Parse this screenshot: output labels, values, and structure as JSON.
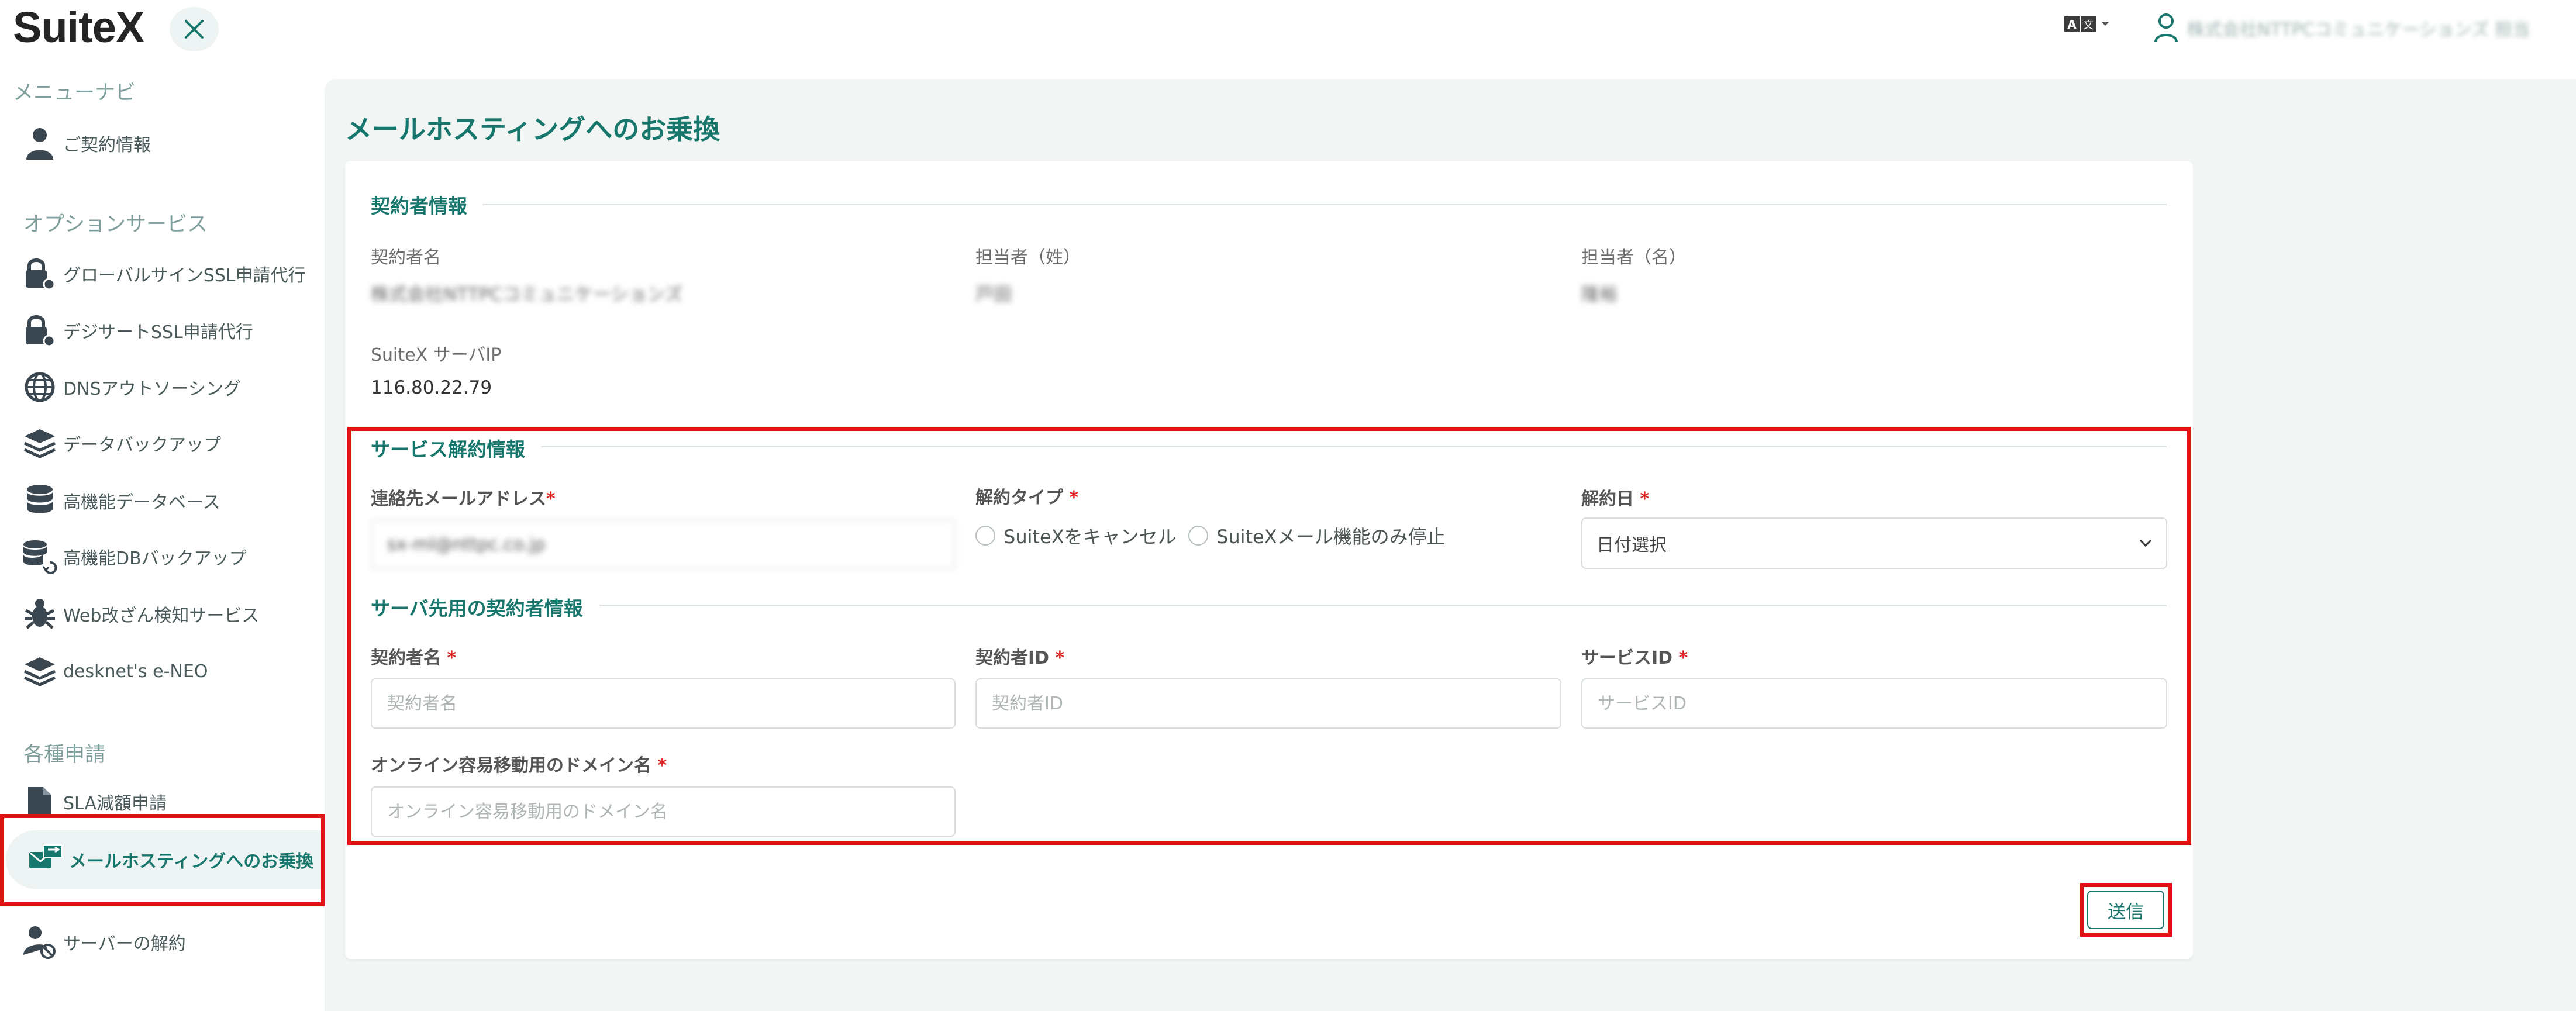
{
  "header": {
    "logo": "SuiteX",
    "user_name": "株式会社NTTPCコミュニケーションズ 担当"
  },
  "sidebar": {
    "menu_title": "メニューナビ",
    "contract_info": "ご契約情報",
    "options_title": "オプションサービス",
    "options": [
      {
        "label": "グローバルサインSSL申請代行",
        "icon": "lock-gear-icon"
      },
      {
        "label": "デジサートSSL申請代行",
        "icon": "lock-gear-icon"
      },
      {
        "label": "DNSアウトソーシング",
        "icon": "globe-icon"
      },
      {
        "label": "データバックアップ",
        "icon": "layers-icon"
      },
      {
        "label": "高機能データベース",
        "icon": "database-icon"
      },
      {
        "label": "高機能DBバックアップ",
        "icon": "database-restore-icon"
      },
      {
        "label": "Web改ざん検知サービス",
        "icon": "bug-icon"
      },
      {
        "label": "desknet's e-NEO",
        "icon": "layers-icon"
      }
    ],
    "requests_title": "各種申請",
    "requests": [
      {
        "label": "SLA減額申請",
        "icon": "document-icon"
      },
      {
        "label": "メールホスティングへのお乗換",
        "icon": "mail-transfer-icon"
      },
      {
        "label": "サーバーの解約",
        "icon": "user-block-icon"
      }
    ]
  },
  "main": {
    "page_title": "メールホスティングへのお乗換",
    "contractor": {
      "title": "契約者情報",
      "name_label": "契約者名",
      "name_value": "株式会社NTTPCコミュニケーションズ",
      "last_label": "担当者（姓）",
      "last_value": "戸田",
      "first_label": "担当者（名）",
      "first_value": "隆裕",
      "ip_label": "SuiteX サーバIP",
      "ip_value": "116.80.22.79"
    },
    "cancel": {
      "title": "サービス解約情報",
      "email_label": "連絡先メールアドレス",
      "email_value": "sx-ml@nttpc.co.jp",
      "type_label": "解約タイプ",
      "type_options": [
        "SuiteXをキャンセル",
        "SuiteXメール機能のみ停止"
      ],
      "date_label": "解約日",
      "date_value": "日付選択"
    },
    "transfer": {
      "title": "サーバ先用の契約者情報",
      "name_label": "契約者名",
      "name_placeholder": "契約者名",
      "id_label": "契約者ID",
      "id_placeholder": "契約者ID",
      "service_label": "サービスID",
      "service_placeholder": "サービスID",
      "domain_label": "オンライン容易移動用のドメイン名",
      "domain_placeholder": "オンライン容易移動用のドメイン名"
    },
    "required_mark": "*",
    "submit_label": "送信"
  },
  "colors": {
    "accent": "#17776c",
    "highlight": "#e01212",
    "required": "#e02323"
  }
}
